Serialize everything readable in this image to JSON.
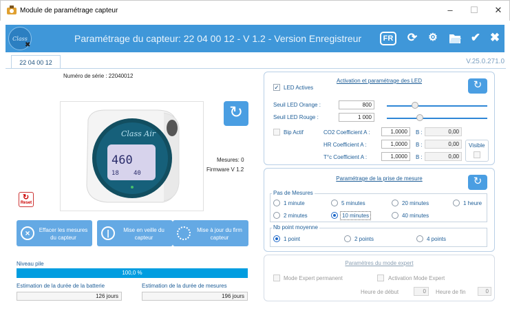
{
  "window": {
    "title": "Module de paramétrage capteur",
    "minimize": "–",
    "maximize": "☐",
    "close": "✕"
  },
  "header": {
    "logo_text": "Class Air",
    "title": "Paramétrage du capteur:  22 04 00 12 - V 1.2 -  Version Enregistreur",
    "lang": "FR",
    "icons": [
      "sync-icon",
      "settings-gears-icon",
      "folder-open-icon",
      "check-icon",
      "close-icon"
    ]
  },
  "version": "V.25.0.271.0",
  "tab": {
    "label": "22 04 00 12"
  },
  "device": {
    "serial": "Numéro de série : 22040012",
    "screen_reading": "460",
    "screen_temp": "18",
    "screen_hum": "40",
    "brand": "Class Air",
    "mesures": "Mesures: 0",
    "firmware": "Firmware V 1.2",
    "reset_label": "Reset"
  },
  "buttons": {
    "erase": "Effacer les mesures du capteur",
    "standby": "Mise en veille du capteur",
    "update": "Mise à jour du firm capteur"
  },
  "battery": {
    "label": "Niveau pile",
    "value": "100,0 %",
    "level": 1.0,
    "est_battery_label": "Estimation de la durée de la batterie",
    "est_battery_value": "126 jours",
    "est_measures_label": "Estimation de la durée de mesures",
    "est_measures_value": "196 jours"
  },
  "led": {
    "title": "Activation et paramétrage des LED",
    "active_label": "LED Actives",
    "active_checked": true,
    "orange_label": "Seuil LED Orange :",
    "orange_value": "800",
    "orange_level": 0.28,
    "rouge_label": "Seuil LED Rouge :",
    "rouge_value": "1 000",
    "rouge_level": 0.33,
    "bip_label": "Bip Actif",
    "co2_label": "CO2 Coefficient A :",
    "co2_a": "1,0000",
    "co2_b": "0,00",
    "hr_label": "HR  Coefficient A :",
    "hr_a": "1,0000",
    "hr_b": "0,00",
    "t_label": "T°c  Coefficient A :",
    "t_a": "1,0000",
    "t_b": "0,00",
    "b_label": "B :",
    "visible_label": "Visible"
  },
  "measure": {
    "title": "Paramétrage de la prise de mesure",
    "step_group": "Pas de Mesures",
    "steps": [
      "1 minute",
      "5 minutes",
      "20 minutes",
      "1 heure",
      "2 minutes",
      "10 minutes",
      "40 minutes"
    ],
    "selected_step": "10 minutes",
    "avg_group": "Nb point moyenne",
    "avg": [
      "1 point",
      "2 points",
      "4 points"
    ],
    "selected_avg": "1 point"
  },
  "expert": {
    "title": "Paramètres du mode expert",
    "permanent_label": "Mode Expert permanent",
    "activation_label": "Activation Mode Expert",
    "start_label": "Heure de début",
    "start_value": "0",
    "end_label": "Heure de fin",
    "end_value": "0"
  },
  "colors": {
    "header": "#3f97d9",
    "accent": "#009de0",
    "button": "#4a9ee2"
  }
}
